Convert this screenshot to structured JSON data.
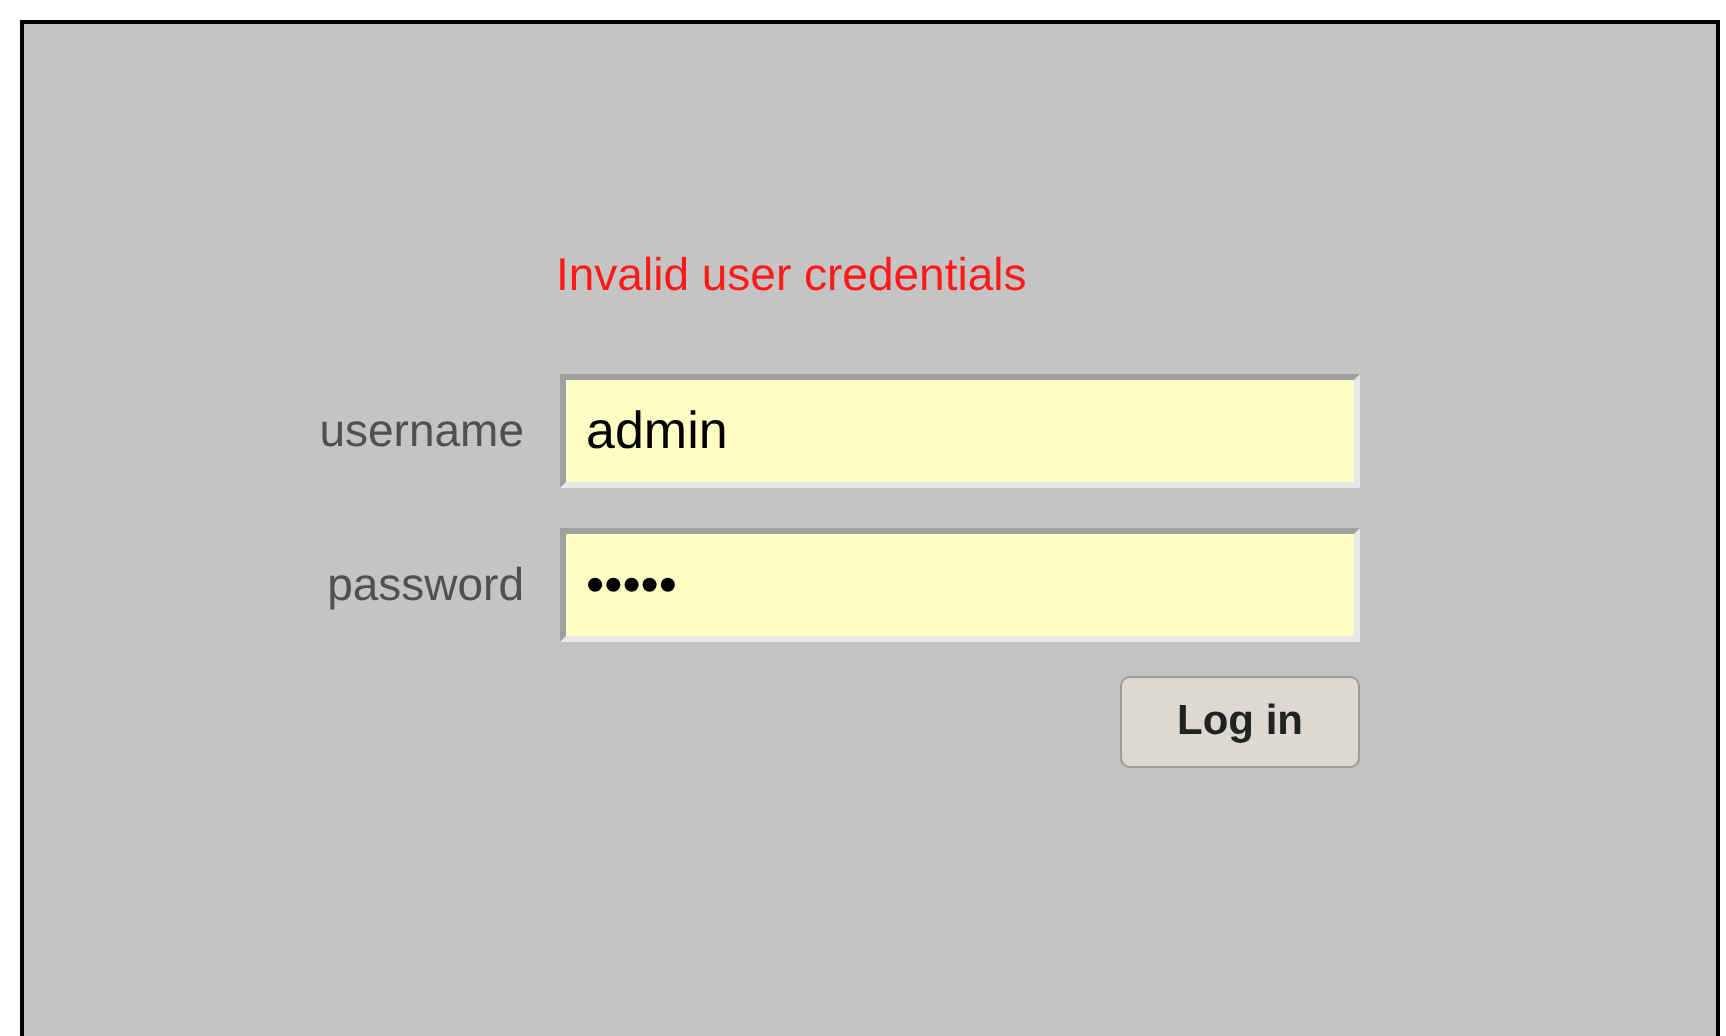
{
  "error": "Invalid user credentials",
  "fields": [
    {
      "label": "username",
      "value": "admin"
    },
    {
      "label": "password",
      "value": "•••••"
    }
  ],
  "button": "Log in"
}
